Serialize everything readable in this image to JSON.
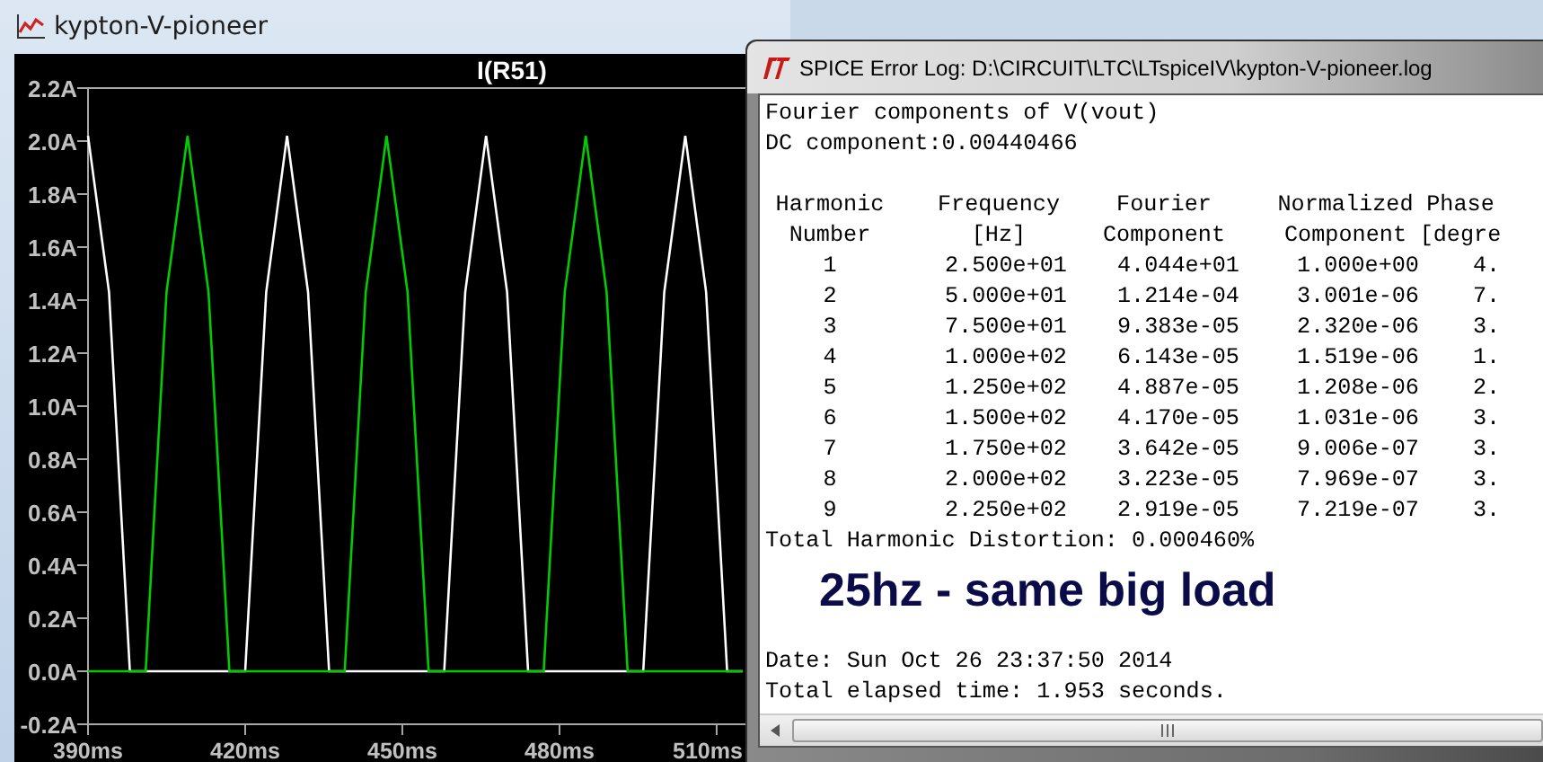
{
  "plot_window": {
    "title": "kypton-V-pioneer",
    "chart_data": {
      "type": "line",
      "title": "I(R51)",
      "x": [
        390,
        394,
        398,
        401,
        405,
        409,
        413,
        417,
        420,
        424,
        428,
        432,
        436,
        439,
        443,
        447,
        451,
        455,
        458,
        462,
        466,
        470,
        474,
        477,
        481,
        485,
        489,
        493,
        496,
        500,
        504,
        508,
        512,
        515
      ],
      "series": [
        {
          "color": "#ffffff",
          "values": [
            2.02,
            1.43,
            0,
            0,
            0,
            0,
            0,
            0,
            0,
            1.43,
            2.02,
            1.43,
            0,
            0,
            0,
            0,
            0,
            0,
            0,
            1.43,
            2.02,
            1.43,
            0,
            0,
            0,
            0,
            0,
            0,
            0,
            1.43,
            2.02,
            1.43,
            0,
            0
          ]
        },
        {
          "color": "#00cc00",
          "values": [
            0,
            0,
            0,
            0,
            1.43,
            2.02,
            1.43,
            0,
            0,
            0,
            0,
            0,
            0,
            0,
            1.43,
            2.02,
            1.43,
            0,
            0,
            0,
            0,
            0,
            0,
            0,
            1.43,
            2.02,
            1.43,
            0,
            0,
            0,
            0,
            0,
            0,
            0
          ]
        }
      ],
      "xlim": [
        390,
        515.5
      ],
      "ylim": [
        -0.2,
        2.2
      ],
      "xticks": [
        {
          "value": 390,
          "label": "390ms"
        },
        {
          "value": 420,
          "label": "420ms"
        },
        {
          "value": 450,
          "label": "450ms"
        },
        {
          "value": 480,
          "label": "480ms"
        },
        {
          "value": 510,
          "label": "510ms"
        }
      ],
      "yticks": [
        {
          "value": 2.2,
          "label": "2.2A"
        },
        {
          "value": 2.0,
          "label": "2.0A"
        },
        {
          "value": 1.8,
          "label": "1.8A"
        },
        {
          "value": 1.6,
          "label": "1.6A"
        },
        {
          "value": 1.4,
          "label": "1.4A"
        },
        {
          "value": 1.2,
          "label": "1.2A"
        },
        {
          "value": 1.0,
          "label": "1.0A"
        },
        {
          "value": 0.8,
          "label": "0.8A"
        },
        {
          "value": 0.6,
          "label": "0.6A"
        },
        {
          "value": 0.4,
          "label": "0.4A"
        },
        {
          "value": 0.2,
          "label": "0.2A"
        },
        {
          "value": 0.0,
          "label": "0.0A"
        },
        {
          "value": -0.2,
          "label": "-0.2A"
        }
      ]
    }
  },
  "log_window": {
    "title": "SPICE Error Log: D:\\CIRCUIT\\LTC\\LTspiceIV\\kypton-V-pioneer.log",
    "lines_top": [
      "Fourier components of V(vout)",
      "DC component:0.00440466"
    ],
    "table": {
      "header_rows": [
        [
          "Harmonic",
          "Frequency",
          "Fourier",
          "Normalized",
          "Phase"
        ],
        [
          "Number",
          "[Hz]",
          "Component",
          "Component",
          "[degre"
        ]
      ],
      "rows": [
        [
          "1",
          "2.500e+01",
          "4.044e+01",
          "1.000e+00",
          "4."
        ],
        [
          "2",
          "5.000e+01",
          "1.214e-04",
          "3.001e-06",
          "7."
        ],
        [
          "3",
          "7.500e+01",
          "9.383e-05",
          "2.320e-06",
          "3."
        ],
        [
          "4",
          "1.000e+02",
          "6.143e-05",
          "1.519e-06",
          "1."
        ],
        [
          "5",
          "1.250e+02",
          "4.887e-05",
          "1.208e-06",
          "2."
        ],
        [
          "6",
          "1.500e+02",
          "4.170e-05",
          "1.031e-06",
          "3."
        ],
        [
          "7",
          "1.750e+02",
          "3.642e-05",
          "9.006e-07",
          "3."
        ],
        [
          "8",
          "2.000e+02",
          "3.223e-05",
          "7.969e-07",
          "3."
        ],
        [
          "9",
          "2.250e+02",
          "2.919e-05",
          "7.219e-07",
          "3."
        ]
      ]
    },
    "thd": "Total Harmonic Distortion: 0.000460%",
    "annotation": "25hz - same big load",
    "footer_lines": [
      "Date: Sun Oct 26 23:37:50 2014",
      "Total elapsed time: 1.953 seconds."
    ]
  }
}
